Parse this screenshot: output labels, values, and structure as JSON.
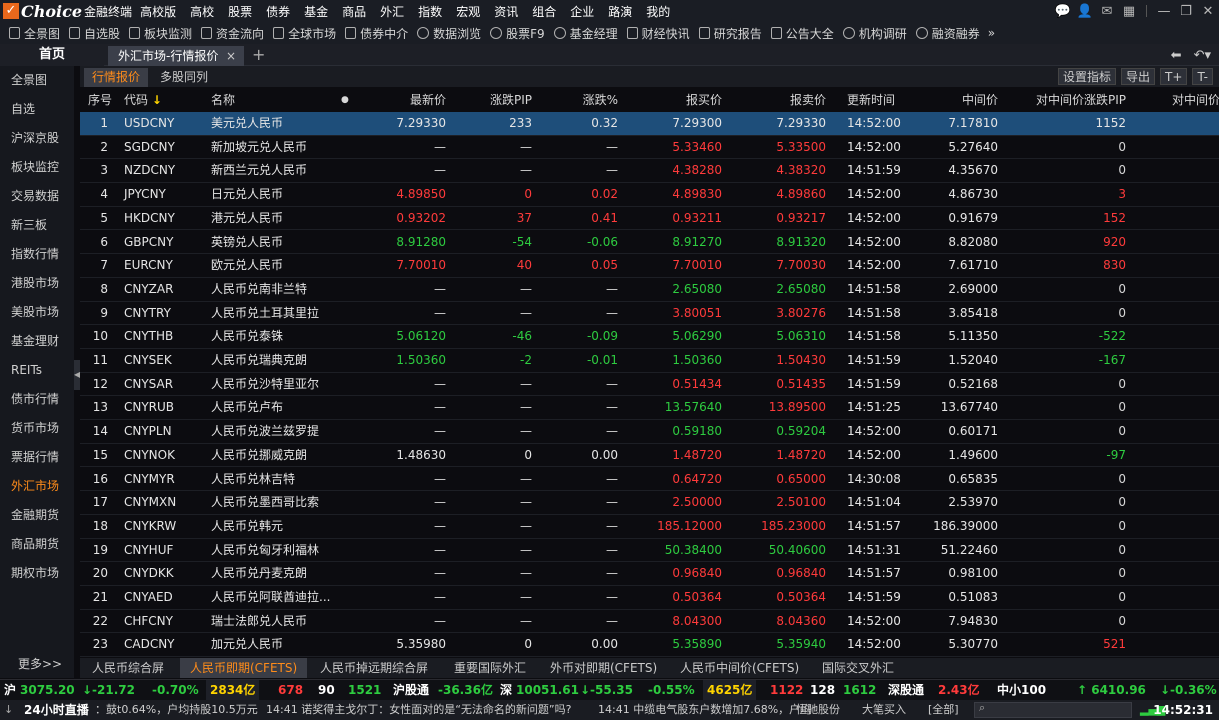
{
  "menubar": {
    "logo": "Choice",
    "logo_sub": "金融终端",
    "edition": "高校版",
    "items": [
      "高校",
      "股票",
      "债券",
      "基金",
      "商品",
      "外汇",
      "指数",
      "宏观",
      "资讯",
      "组合",
      "企业",
      "路演",
      "我的"
    ]
  },
  "toolbar": {
    "items": [
      "全景图",
      "自选股",
      "板块监测",
      "资金流向",
      "全球市场",
      "债券中介",
      "数据浏览",
      "股票F9",
      "基金经理",
      "财经快讯",
      "研究报告",
      "公告大全",
      "机构调研",
      "融资融券"
    ],
    "more": "»"
  },
  "tabs": {
    "home": "首页",
    "active": "外汇市场-行情报价",
    "close": "×",
    "new": "+"
  },
  "sidebar": {
    "items": [
      "全景图",
      "自选",
      "沪深京股",
      "板块监控",
      "交易数据",
      "新三板",
      "指数行情",
      "港股市场",
      "美股市场",
      "基金理财",
      "REITs",
      "债市行情",
      "货币市场",
      "票据行情",
      "外汇市场",
      "金融期货",
      "商品期货",
      "期权市场"
    ],
    "active_index": 14,
    "more": "更多>>"
  },
  "subtabs": {
    "tab1": "行情报价",
    "tab2": "多股同列",
    "btn_settings": "设置指标",
    "btn_export": "导出",
    "btn_plus": "T+",
    "btn_minus": "T-"
  },
  "table": {
    "headers": {
      "seq": "序号",
      "code": "代码",
      "sort_arrow": "↓",
      "name": "名称",
      "dot": "●",
      "last": "最新价",
      "pip": "涨跌PIP",
      "pct": "涨跌%",
      "bid": "报买价",
      "ask": "报卖价",
      "time": "更新时间",
      "mid": "中间价",
      "mid_pip": "对中间价涨跌PIP",
      "mid_more": "对中间价"
    },
    "rows": [
      {
        "seq": "1",
        "code": "USDCNY",
        "name": "美元兑人民币",
        "last": "7.29330",
        "pip": "233",
        "pct": "0.32",
        "bid": "7.29300",
        "ask": "7.29330",
        "time": "14:52:00",
        "mid": "7.17810",
        "mid_pip": "1152",
        "c_last": "white",
        "c_chg": "white",
        "c_bid": "white",
        "c_ask": "white",
        "c_mid_pip": "white"
      },
      {
        "seq": "2",
        "code": "SGDCNY",
        "name": "新加坡元兑人民币",
        "last": "—",
        "pip": "—",
        "pct": "—",
        "bid": "5.33460",
        "ask": "5.33500",
        "time": "14:52:00",
        "mid": "5.27640",
        "mid_pip": "0",
        "c_last": "flat",
        "c_chg": "flat",
        "c_bid": "up",
        "c_ask": "up",
        "c_mid_pip": "flat"
      },
      {
        "seq": "3",
        "code": "NZDCNY",
        "name": "新西兰元兑人民币",
        "last": "—",
        "pip": "—",
        "pct": "—",
        "bid": "4.38280",
        "ask": "4.38320",
        "time": "14:51:59",
        "mid": "4.35670",
        "mid_pip": "0",
        "c_last": "flat",
        "c_chg": "flat",
        "c_bid": "up",
        "c_ask": "up",
        "c_mid_pip": "flat"
      },
      {
        "seq": "4",
        "code": "JPYCNY",
        "name": "日元兑人民币",
        "last": "4.89850",
        "pip": "0",
        "pct": "0.02",
        "bid": "4.89830",
        "ask": "4.89860",
        "time": "14:52:00",
        "mid": "4.86730",
        "mid_pip": "3",
        "c_last": "up",
        "c_chg": "up",
        "c_bid": "up",
        "c_ask": "up",
        "c_mid_pip": "up"
      },
      {
        "seq": "5",
        "code": "HKDCNY",
        "name": "港元兑人民币",
        "last": "0.93202",
        "pip": "37",
        "pct": "0.41",
        "bid": "0.93211",
        "ask": "0.93217",
        "time": "14:52:00",
        "mid": "0.91679",
        "mid_pip": "152",
        "c_last": "up",
        "c_chg": "up",
        "c_bid": "up",
        "c_ask": "up",
        "c_mid_pip": "up"
      },
      {
        "seq": "6",
        "code": "GBPCNY",
        "name": "英镑兑人民币",
        "last": "8.91280",
        "pip": "-54",
        "pct": "-0.06",
        "bid": "8.91270",
        "ask": "8.91320",
        "time": "14:52:00",
        "mid": "8.82080",
        "mid_pip": "920",
        "c_last": "down",
        "c_chg": "down",
        "c_bid": "down",
        "c_ask": "down",
        "c_mid_pip": "up"
      },
      {
        "seq": "7",
        "code": "EURCNY",
        "name": "欧元兑人民币",
        "last": "7.70010",
        "pip": "40",
        "pct": "0.05",
        "bid": "7.70010",
        "ask": "7.70030",
        "time": "14:52:00",
        "mid": "7.61710",
        "mid_pip": "830",
        "c_last": "up",
        "c_chg": "up",
        "c_bid": "up",
        "c_ask": "up",
        "c_mid_pip": "up"
      },
      {
        "seq": "8",
        "code": "CNYZAR",
        "name": "人民币兑南非兰特",
        "last": "—",
        "pip": "—",
        "pct": "—",
        "bid": "2.65080",
        "ask": "2.65080",
        "time": "14:51:58",
        "mid": "2.69000",
        "mid_pip": "0",
        "c_last": "flat",
        "c_chg": "flat",
        "c_bid": "down",
        "c_ask": "down",
        "c_mid_pip": "flat"
      },
      {
        "seq": "9",
        "code": "CNYTRY",
        "name": "人民币兑土耳其里拉",
        "last": "—",
        "pip": "—",
        "pct": "—",
        "bid": "3.80051",
        "ask": "3.80276",
        "time": "14:51:58",
        "mid": "3.85418",
        "mid_pip": "0",
        "c_last": "flat",
        "c_chg": "flat",
        "c_bid": "up",
        "c_ask": "up",
        "c_mid_pip": "flat"
      },
      {
        "seq": "10",
        "code": "CNYTHB",
        "name": "人民币兑泰铢",
        "last": "5.06120",
        "pip": "-46",
        "pct": "-0.09",
        "bid": "5.06290",
        "ask": "5.06310",
        "time": "14:51:58",
        "mid": "5.11350",
        "mid_pip": "-522",
        "c_last": "down",
        "c_chg": "down",
        "c_bid": "down",
        "c_ask": "down",
        "c_mid_pip": "down"
      },
      {
        "seq": "11",
        "code": "CNYSEK",
        "name": "人民币兑瑞典克朗",
        "last": "1.50360",
        "pip": "-2",
        "pct": "-0.01",
        "bid": "1.50360",
        "ask": "1.50430",
        "time": "14:51:59",
        "mid": "1.52040",
        "mid_pip": "-167",
        "c_last": "down",
        "c_chg": "down",
        "c_bid": "down",
        "c_ask": "up",
        "c_mid_pip": "down"
      },
      {
        "seq": "12",
        "code": "CNYSAR",
        "name": "人民币兑沙特里亚尔",
        "last": "—",
        "pip": "—",
        "pct": "—",
        "bid": "0.51434",
        "ask": "0.51435",
        "time": "14:51:59",
        "mid": "0.52168",
        "mid_pip": "0",
        "c_last": "flat",
        "c_chg": "flat",
        "c_bid": "up",
        "c_ask": "up",
        "c_mid_pip": "flat"
      },
      {
        "seq": "13",
        "code": "CNYRUB",
        "name": "人民币兑卢布",
        "last": "—",
        "pip": "—",
        "pct": "—",
        "bid": "13.57640",
        "ask": "13.89500",
        "time": "14:51:25",
        "mid": "13.67740",
        "mid_pip": "0",
        "c_last": "flat",
        "c_chg": "flat",
        "c_bid": "down",
        "c_ask": "up",
        "c_mid_pip": "flat"
      },
      {
        "seq": "14",
        "code": "CNYPLN",
        "name": "人民币兑波兰兹罗提",
        "last": "—",
        "pip": "—",
        "pct": "—",
        "bid": "0.59180",
        "ask": "0.59204",
        "time": "14:52:00",
        "mid": "0.60171",
        "mid_pip": "0",
        "c_last": "flat",
        "c_chg": "flat",
        "c_bid": "down",
        "c_ask": "down",
        "c_mid_pip": "flat"
      },
      {
        "seq": "15",
        "code": "CNYNOK",
        "name": "人民币兑挪威克朗",
        "last": "1.48630",
        "pip": "0",
        "pct": "0.00",
        "bid": "1.48720",
        "ask": "1.48720",
        "time": "14:52:00",
        "mid": "1.49600",
        "mid_pip": "-97",
        "c_last": "white",
        "c_chg": "white",
        "c_bid": "up",
        "c_ask": "up",
        "c_mid_pip": "down"
      },
      {
        "seq": "16",
        "code": "CNYMYR",
        "name": "人民币兑林吉特",
        "last": "—",
        "pip": "—",
        "pct": "—",
        "bid": "0.64720",
        "ask": "0.65000",
        "time": "14:30:08",
        "mid": "0.65835",
        "mid_pip": "0",
        "c_last": "flat",
        "c_chg": "flat",
        "c_bid": "up",
        "c_ask": "up",
        "c_mid_pip": "flat"
      },
      {
        "seq": "17",
        "code": "CNYMXN",
        "name": "人民币兑墨西哥比索",
        "last": "—",
        "pip": "—",
        "pct": "—",
        "bid": "2.50000",
        "ask": "2.50100",
        "time": "14:51:04",
        "mid": "2.53970",
        "mid_pip": "0",
        "c_last": "flat",
        "c_chg": "flat",
        "c_bid": "up",
        "c_ask": "up",
        "c_mid_pip": "flat"
      },
      {
        "seq": "18",
        "code": "CNYKRW",
        "name": "人民币兑韩元",
        "last": "—",
        "pip": "—",
        "pct": "—",
        "bid": "185.12000",
        "ask": "185.23000",
        "time": "14:51:57",
        "mid": "186.39000",
        "mid_pip": "0",
        "c_last": "flat",
        "c_chg": "flat",
        "c_bid": "up",
        "c_ask": "up",
        "c_mid_pip": "flat"
      },
      {
        "seq": "19",
        "code": "CNYHUF",
        "name": "人民币兑匈牙利福林",
        "last": "—",
        "pip": "—",
        "pct": "—",
        "bid": "50.38400",
        "ask": "50.40600",
        "time": "14:51:31",
        "mid": "51.22460",
        "mid_pip": "0",
        "c_last": "flat",
        "c_chg": "flat",
        "c_bid": "down",
        "c_ask": "down",
        "c_mid_pip": "flat"
      },
      {
        "seq": "20",
        "code": "CNYDKK",
        "name": "人民币兑丹麦克朗",
        "last": "—",
        "pip": "—",
        "pct": "—",
        "bid": "0.96840",
        "ask": "0.96840",
        "time": "14:51:57",
        "mid": "0.98100",
        "mid_pip": "0",
        "c_last": "flat",
        "c_chg": "flat",
        "c_bid": "up",
        "c_ask": "up",
        "c_mid_pip": "flat"
      },
      {
        "seq": "21",
        "code": "CNYAED",
        "name": "人民币兑阿联酋迪拉...",
        "last": "—",
        "pip": "—",
        "pct": "—",
        "bid": "0.50364",
        "ask": "0.50364",
        "time": "14:51:59",
        "mid": "0.51083",
        "mid_pip": "0",
        "c_last": "flat",
        "c_chg": "flat",
        "c_bid": "up",
        "c_ask": "up",
        "c_mid_pip": "flat"
      },
      {
        "seq": "22",
        "code": "CHFCNY",
        "name": "瑞士法郎兑人民币",
        "last": "—",
        "pip": "—",
        "pct": "—",
        "bid": "8.04300",
        "ask": "8.04360",
        "time": "14:52:00",
        "mid": "7.94830",
        "mid_pip": "0",
        "c_last": "flat",
        "c_chg": "flat",
        "c_bid": "up",
        "c_ask": "up",
        "c_mid_pip": "flat"
      },
      {
        "seq": "23",
        "code": "CADCNY",
        "name": "加元兑人民币",
        "last": "5.35980",
        "pip": "0",
        "pct": "0.00",
        "bid": "5.35890",
        "ask": "5.35940",
        "time": "14:52:00",
        "mid": "5.30770",
        "mid_pip": "521",
        "c_last": "white",
        "c_chg": "white",
        "c_bid": "down",
        "c_ask": "down",
        "c_mid_pip": "up"
      }
    ]
  },
  "bottom_tabs": [
    "人民币综合屏",
    "人民币即期(CFETS)",
    "人民币掉远期综合屏",
    "重要国际外汇",
    "外币对即期(CFETS)",
    "人民币中间价(CFETS)",
    "国际交叉外汇"
  ],
  "bottom_active": 1,
  "status": {
    "sh_label": "沪",
    "sh_index": "3075.20",
    "sh_chg": "↓-21.72",
    "sh_pct": "-0.70%",
    "sh_amount": "2834亿",
    "sh_up": "678",
    "sh_flat": "90",
    "sh_down": "1521",
    "hgt_label": "沪股通",
    "hgt_val": "-36.36亿",
    "sz_label": "深",
    "sz_index": "10051.61",
    "sz_chg": "↓-55.35",
    "sz_pct": "-0.55%",
    "sz_amount": "4625亿",
    "sz_up": "1122",
    "sz_flat": "128",
    "sz_down": "1612",
    "sgt_label": "深股通",
    "sgt_val": "2.43亿",
    "zxb_label": "中小100",
    "zxb_index": "↑ 6410.96",
    "zxb_pct": "↓-0.36%"
  },
  "news": {
    "live_label": "24小时直播",
    "ticker1": "：鼓t0.64%，户均持股10.5万元",
    "ticker2": "14:41 诺奖得主戈尔丁：女性面对的是“无法命名的新问题”吗?",
    "ticker3": "14:41 中缆电气股东户数增加7.68%，户均",
    "ticker4": "恒驰股份",
    "ticker5": "大笔买入",
    "ticker6": "[全部]",
    "clock": "14:52:31"
  }
}
